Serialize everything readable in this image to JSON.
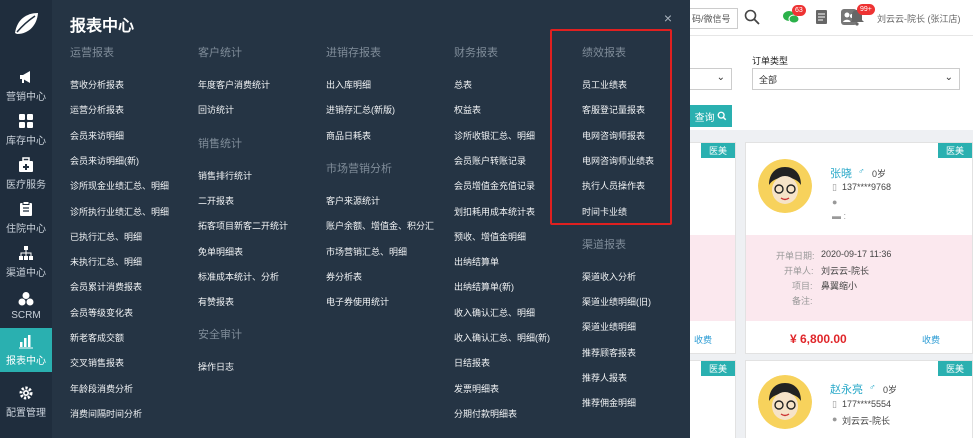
{
  "sidebar": {
    "items": [
      {
        "label": "营销中心",
        "icon": "megaphone-icon"
      },
      {
        "label": "库存中心",
        "icon": "grid-icon"
      },
      {
        "label": "医疗服务",
        "icon": "medkit-icon"
      },
      {
        "label": "住院中心",
        "icon": "clipboard-icon"
      },
      {
        "label": "渠道中心",
        "icon": "org-chart-icon"
      },
      {
        "label": "SCRM",
        "icon": "cluster-icon"
      },
      {
        "label": "报表中心",
        "icon": "bar-chart-icon"
      },
      {
        "label": "配置管理",
        "icon": "gear-icon"
      }
    ]
  },
  "panel": {
    "title": "报表中心",
    "close": "×",
    "columns": [
      {
        "heading": "运营报表",
        "links": [
          "营收分析报表",
          "运营分析报表",
          "会员来访明细",
          "会员来访明细(新)",
          "诊所现金业绩汇总、明细",
          "诊所执行业绩汇总、明细",
          "已执行汇总、明细",
          "未执行汇总、明细",
          "会员累计消费报表",
          "会员等级变化表",
          "新老客成交额",
          "交叉销售报表",
          "年龄段消费分析",
          "消费间隔时间分析"
        ]
      },
      {
        "heading": "客户统计",
        "links": [
          "年度客户消费统计",
          "回访统计"
        ],
        "heading2": "销售统计",
        "links2": [
          "销售排行统计",
          "二开报表",
          "拓客项目新客二开统计",
          "免单明细表",
          "标准成本统计、分析",
          "有赞报表"
        ],
        "heading3": "安全审计",
        "links3": [
          "操作日志"
        ]
      },
      {
        "heading": "进销存报表",
        "links": [
          "出入库明细",
          "进销存汇总(新版)",
          "商品日耗表"
        ],
        "heading2": "市场营销分析",
        "links2": [
          "客户来源统计",
          "账户余额、增值金、积分汇",
          "市场营销汇总、明细",
          "券分析表",
          "电子券使用统计"
        ]
      },
      {
        "heading": "财务报表",
        "links": [
          "总表",
          "权益表",
          "诊所收银汇总、明细",
          "会员账户转账记录",
          "会员增值金充值记录",
          "划扣耗用成本统计表",
          "预收、增值金明细",
          "出纳结算单",
          "出纳结算单(新)",
          "收入确认汇总、明细",
          "收入确认汇总、明细(新)",
          "日结报表",
          "发票明细表",
          "分期付款明细表"
        ]
      },
      {
        "heading": "绩效报表",
        "links": [
          "员工业绩表",
          "客服登记量报表",
          "电网咨询师报表",
          "电网咨询师业绩表",
          "执行人员操作表",
          "时间卡业绩"
        ],
        "heading2": "渠道报表",
        "links2": [
          "渠道收入分析",
          "渠道业绩明细(旧)",
          "渠道业绩明细",
          "推荐顾客报表",
          "推荐人报表",
          "推荐佣金明细"
        ]
      }
    ]
  },
  "topbar": {
    "search_text": "码/微信号",
    "chat_badge": "63",
    "bell_badge": "99+",
    "user": "刘云云-院长 (张江店)"
  },
  "filter": {
    "order_type_label": "订单类型",
    "order_type_value": "全部",
    "query_label": "查询"
  },
  "cards": [
    {
      "tag": "医美",
      "name": "张晓",
      "gender": "♂",
      "age": "0岁",
      "phone": "137****9768",
      "open_date_label": "开单日期:",
      "open_date": "2020-09-17 11:36",
      "staff_label": "开单人:",
      "staff": "刘云云-院长",
      "item_label": "项目:",
      "item": "鼻翼缩小",
      "remark_label": "备注:",
      "price": "¥ 6,800.00",
      "action": "收费"
    },
    {
      "tag": "医美",
      "name": "赵永亮",
      "gender": "♂",
      "age": "0岁",
      "phone": "177****5554",
      "staff": "刘云云-院长"
    }
  ],
  "left_cards": [
    {
      "tag": "医美",
      "action": "收费"
    },
    {
      "tag": "医美"
    }
  ],
  "colors": {
    "sidebar": "#1f2d3d",
    "panel": "#253444",
    "accent": "#2ab0b0",
    "highlight": "#e02020",
    "price": "#e0262a"
  }
}
